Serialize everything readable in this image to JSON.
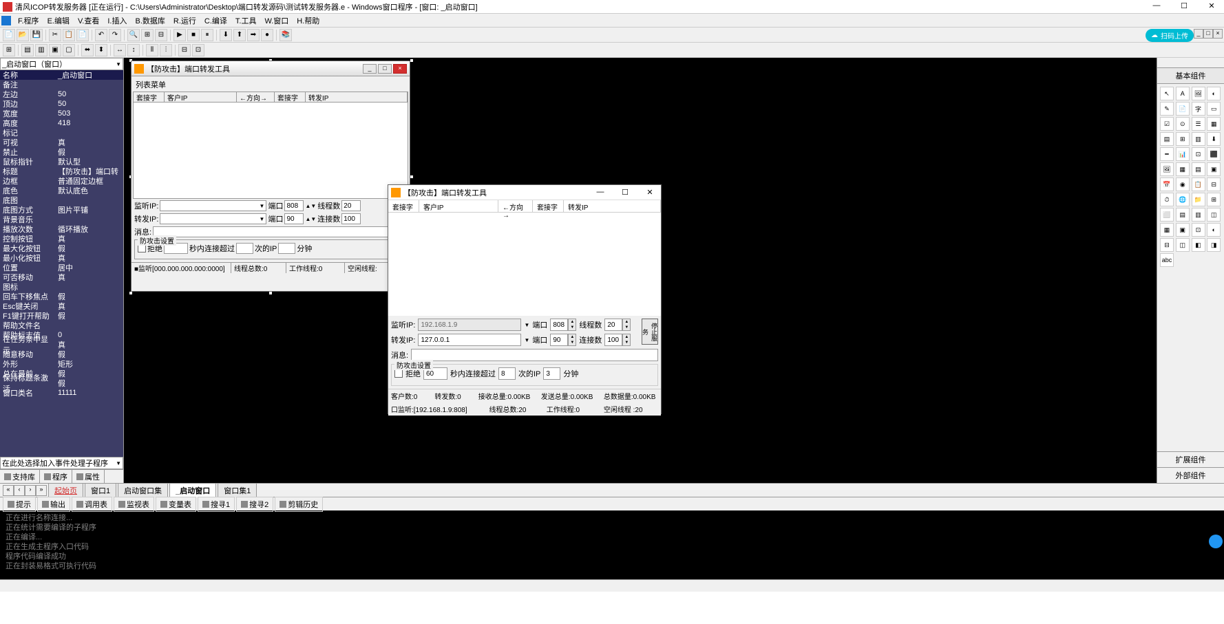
{
  "titlebar": {
    "text": "清风ICOP转发服务器 [正在运行] - C:\\Users\\Administrator\\Desktop\\端口转发源码\\测试转发服务器.e - Windows窗口程序 - [窗口: _启动窗口]"
  },
  "menu": {
    "items": [
      "F.程序",
      "E.编辑",
      "V.查看",
      "I.插入",
      "B.数据库",
      "R.运行",
      "C.编译",
      "T.工具",
      "W.窗口",
      "H.帮助"
    ]
  },
  "upload_btn": "扫码上传",
  "left": {
    "combo_top": "_启动窗口（窗口）",
    "props": [
      {
        "n": "名称",
        "v": "_启动窗口",
        "hdr": true
      },
      {
        "n": "备注",
        "v": ""
      },
      {
        "n": "左边",
        "v": "50"
      },
      {
        "n": "顶边",
        "v": "50"
      },
      {
        "n": "宽度",
        "v": "503"
      },
      {
        "n": "高度",
        "v": "418"
      },
      {
        "n": "标记",
        "v": ""
      },
      {
        "n": "可视",
        "v": "真"
      },
      {
        "n": "禁止",
        "v": "假"
      },
      {
        "n": "鼠标指针",
        "v": "默认型"
      },
      {
        "n": "标题",
        "v": "【防攻击】端口转"
      },
      {
        "n": "边框",
        "v": "普通固定边框"
      },
      {
        "n": "底色",
        "v": "默认底色"
      },
      {
        "n": "底图",
        "v": ""
      },
      {
        "n": "  底图方式",
        "v": "图片平铺"
      },
      {
        "n": "背景音乐",
        "v": ""
      },
      {
        "n": "  播放次数",
        "v": "循环播放"
      },
      {
        "n": "控制按钮",
        "v": "真"
      },
      {
        "n": "  最大化按钮",
        "v": "假"
      },
      {
        "n": "  最小化按钮",
        "v": "真"
      },
      {
        "n": "位置",
        "v": "居中"
      },
      {
        "n": "可否移动",
        "v": "真"
      },
      {
        "n": "图标",
        "v": ""
      },
      {
        "n": "回车下移焦点",
        "v": "假"
      },
      {
        "n": "Esc键关闭",
        "v": "真"
      },
      {
        "n": "F1键打开帮助",
        "v": "假"
      },
      {
        "n": "帮助文件名",
        "v": ""
      },
      {
        "n": "帮助标志值",
        "v": "0"
      },
      {
        "n": "在任务条中显示",
        "v": "真"
      },
      {
        "n": "随意移动",
        "v": "假"
      },
      {
        "n": "外形",
        "v": "矩形"
      },
      {
        "n": "总在最前",
        "v": "假"
      },
      {
        "n": "保持标题条激活",
        "v": "假"
      },
      {
        "n": "窗口类名",
        "v": "11111"
      }
    ],
    "combo_bot": "在此处选择加入事件处理子程序",
    "tabs": [
      "支持库",
      "程序",
      "属性"
    ]
  },
  "design_win": {
    "title": "【防攻击】端口转发工具",
    "menu": "列表菜单",
    "headers": [
      "套接字",
      "客户IP",
      "←方向→",
      "套接字",
      "转发IP"
    ],
    "form": {
      "listen_ip": "监听IP:",
      "port": "端口",
      "port_val": "808",
      "threads": "线程数",
      "threads_val": "20",
      "fwd_ip": "转发IP:",
      "port2_val": "90",
      "conns": "连接数",
      "conns_val": "100",
      "msg": "消息:",
      "group": "防攻击设置",
      "reject": "拒绝",
      "sec_conn": "秒内连接超过",
      "times_ip": "次的IP",
      "minutes": "分钟"
    },
    "status": [
      "■监听[000.000.000.000:0000]",
      "线程总数:0",
      "工作线程:0",
      "空闲线程:"
    ]
  },
  "run_win": {
    "title": "【防攻击】端口转发工具",
    "headers": [
      "套接字",
      "客户IP",
      "←方向→",
      "套接字",
      "转发IP"
    ],
    "form": {
      "listen_ip_lbl": "监听IP:",
      "listen_ip": "192.168.1.9",
      "port_lbl": "端口",
      "port": "808",
      "threads_lbl": "线程数",
      "threads": "20",
      "fwd_ip_lbl": "转发IP:",
      "fwd_ip": "127.0.0.1",
      "port2": "90",
      "conns_lbl": "连接数",
      "conns": "100",
      "stop_btn": "停止服务",
      "msg_lbl": "消息:",
      "group": "防攻击设置",
      "reject": "拒绝",
      "reject_val": "60",
      "sec_conn": "秒内连接超过",
      "sec_val": "8",
      "times_ip": "次的IP",
      "ip_val": "3",
      "minutes": "分钟"
    },
    "status": [
      "客户数:0",
      "转发数:0",
      "接收总量:0.00KB",
      "发送总量:0.00KB",
      "总数据量:0.00KB",
      "口监听:[192.168.1.9:808]",
      "线程总数:20",
      "工作线程:0",
      "空闲线程 :20"
    ]
  },
  "right": {
    "title": "基本组件",
    "ext": "扩展组件",
    "extn": "外部组件"
  },
  "bottom_tabs": {
    "items": [
      "起始页",
      "窗口1",
      "启动窗口集",
      "_启动窗口",
      "窗口集1"
    ]
  },
  "bottom_tools": {
    "items": [
      "提示",
      "输出",
      "调用表",
      "监视表",
      "变量表",
      "搜寻1",
      "搜寻2",
      "剪辑历史"
    ]
  },
  "console": [
    "正在进行名称连接...",
    "正在统计需要编译的子程序",
    "正在编译...",
    "正在生成主程序入口代码",
    "程序代码编译成功",
    "正在封装易格式可执行代码"
  ]
}
